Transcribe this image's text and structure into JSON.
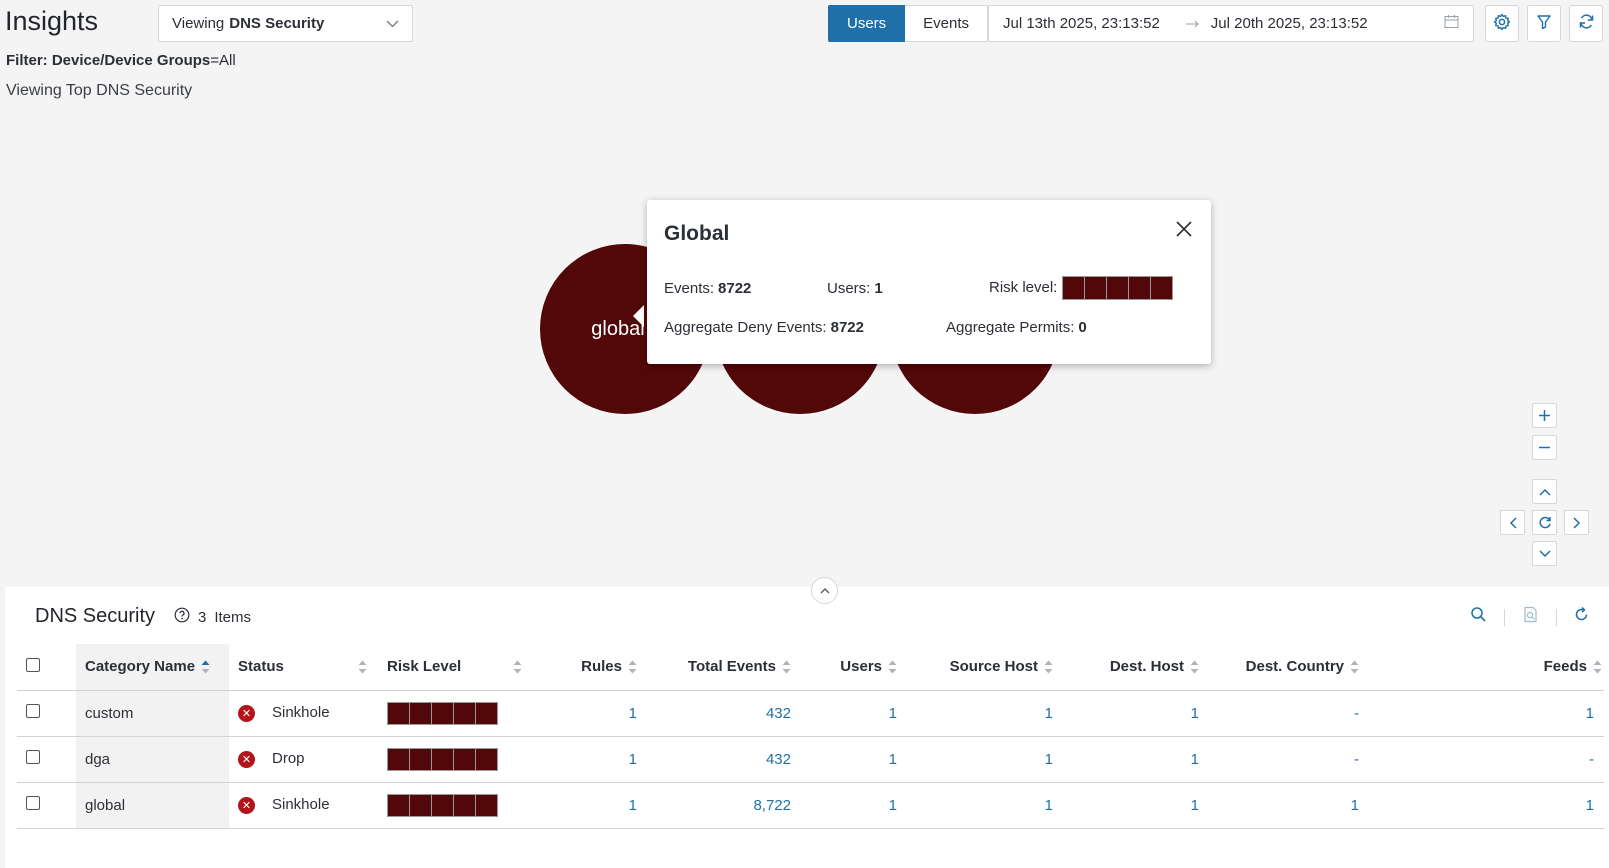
{
  "header": {
    "title": "Insights",
    "viewing_prefix": "Viewing",
    "viewing_value": "DNS Security",
    "toggle": {
      "users_label": "Users",
      "events_label": "Events",
      "active": "Users"
    },
    "date_from": "Jul 13th 2025, 23:13:52",
    "date_to": "Jul 20th 2025, 23:13:52",
    "filter_label": "Filter: Device/Device Groups",
    "filter_value": "=All",
    "viewing_top": "Viewing Top DNS Security"
  },
  "bubbles": [
    {
      "label": "global"
    },
    {
      "label": ""
    },
    {
      "label": ""
    }
  ],
  "popover": {
    "title": "Global",
    "events_label": "Events:",
    "events_value": "8722",
    "users_label": "Users:",
    "users_value": "1",
    "risk_label": "Risk level:",
    "risk_level": 5,
    "deny_label": "Aggregate Deny Events:",
    "deny_value": "8722",
    "permits_label": "Aggregate Permits:",
    "permits_value": "0"
  },
  "panel": {
    "title": "DNS Security",
    "count": "3",
    "count_label": "Items",
    "columns": {
      "category": "Category Name",
      "status": "Status",
      "risk": "Risk Level",
      "rules": "Rules",
      "total_events": "Total Events",
      "users": "Users",
      "source_host": "Source Host",
      "dest_host": "Dest. Host",
      "dest_country": "Dest. Country",
      "feeds": "Feeds"
    },
    "rows": [
      {
        "category": "custom",
        "status": "Sinkhole",
        "risk_level": 5,
        "rules": "1",
        "total_events": "432",
        "users": "1",
        "source_host": "1",
        "dest_host": "1",
        "dest_country": "-",
        "feeds": "1"
      },
      {
        "category": "dga",
        "status": "Drop",
        "risk_level": 5,
        "rules": "1",
        "total_events": "432",
        "users": "1",
        "source_host": "1",
        "dest_host": "1",
        "dest_country": "-",
        "feeds": "-"
      },
      {
        "category": "global",
        "status": "Sinkhole",
        "risk_level": 5,
        "rules": "1",
        "total_events": "8,722",
        "users": "1",
        "source_host": "1",
        "dest_host": "1",
        "dest_country": "1",
        "feeds": "1"
      }
    ]
  },
  "colors": {
    "accent": "#1f6fa8",
    "risk": "#520708",
    "status_error": "#b3141a"
  }
}
